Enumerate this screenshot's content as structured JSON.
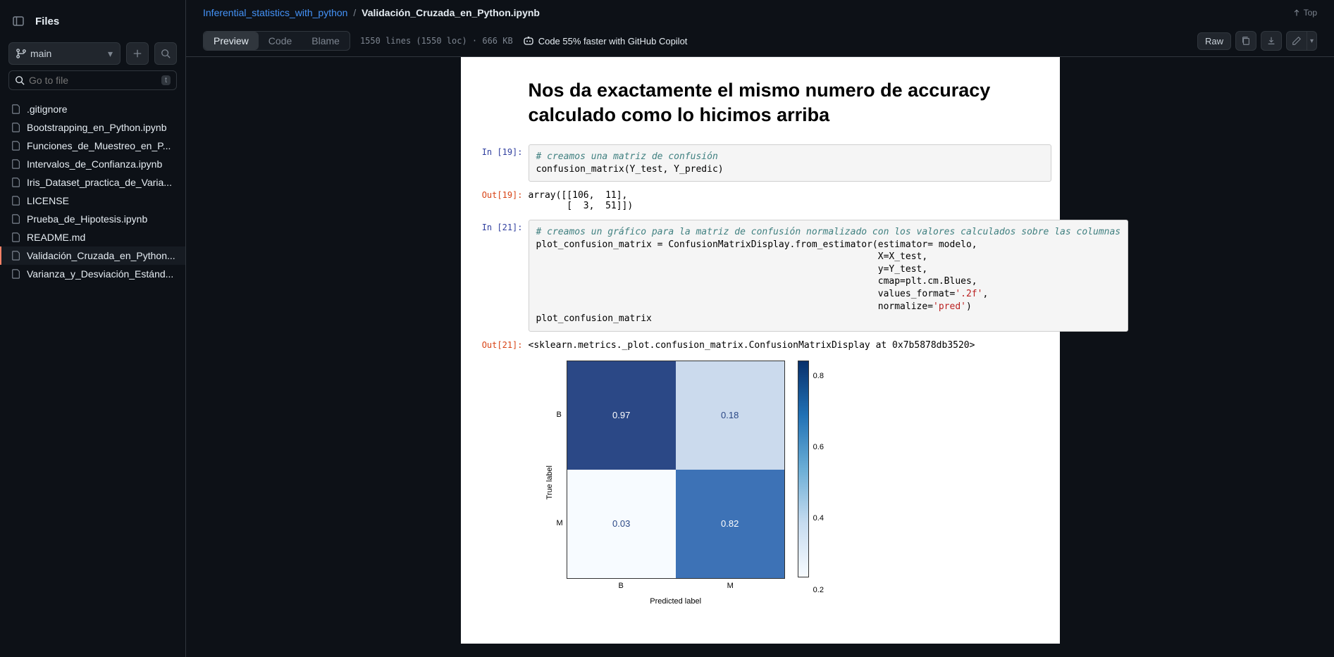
{
  "sidebar": {
    "title": "Files",
    "branch": "main",
    "searchPlaceholder": "Go to file",
    "searchKey": "t",
    "files": [
      ".gitignore",
      "Bootstrapping_en_Python.ipynb",
      "Funciones_de_Muestreo_en_P...",
      "Intervalos_de_Confianza.ipynb",
      "Iris_Dataset_practica_de_Varia...",
      "LICENSE",
      "Prueba_de_Hipotesis.ipynb",
      "README.md",
      "Validación_Cruzada_en_Python...",
      "Varianza_y_Desviación_Estánd..."
    ],
    "activeIndex": 8
  },
  "breadcrumb": {
    "repo": "Inferential_statistics_with_python",
    "file": "Validación_Cruzada_en_Python.ipynb",
    "topLabel": "Top"
  },
  "toolbar": {
    "tabs": [
      "Preview",
      "Code",
      "Blame"
    ],
    "activeTab": 0,
    "meta": "1550 lines (1550 loc) · 666 KB",
    "copilot": "Code 55% faster with GitHub Copilot",
    "raw": "Raw"
  },
  "notebook": {
    "heading": "Nos da exactamente el mismo numero de accuracy calculado como lo hicimos arriba",
    "prompts": {
      "in19": "In [19]:",
      "out19": "Out[19]:",
      "in21": "In [21]:",
      "out21": "Out[21]:"
    },
    "code19_comment": "# creamos una matriz de confusión",
    "code19_line": "confusion_matrix(Y_test, Y_predic)",
    "out19_text": "array([[106,  11],\n       [  3,  51]])",
    "code21_comment": "# creamos un gráfico para la matriz de confusión normalizado con los valores calculados sobre las columnas",
    "code21_body": "plot_confusion_matrix = ConfusionMatrixDisplay.from_estimator(estimator= modelo,\n                                                              X=X_test,\n                                                              y=Y_test,\n                                                              cmap=plt.cm.Blues,\n                                                              values_format=",
    "code21_str1": "'.2f'",
    "code21_body2": ",\n                                                              normalize=",
    "code21_str2": "'pred'",
    "code21_body3": ")\nplot_confusion_matrix",
    "out21_text": "<sklearn.metrics._plot.confusion_matrix.ConfusionMatrixDisplay at 0x7b5878db3520>"
  },
  "chart_data": {
    "type": "heatmap",
    "title": "",
    "xlabel": "Predicted label",
    "ylabel": "True label",
    "x_categories": [
      "B",
      "M"
    ],
    "y_categories": [
      "B",
      "M"
    ],
    "cells": [
      [
        0.97,
        0.18
      ],
      [
        0.03,
        0.82
      ]
    ],
    "colorbar_ticks": [
      "0.8",
      "0.6",
      "0.4",
      "0.2"
    ],
    "cell_colors": [
      [
        "#2b4886",
        "#cbdaed"
      ],
      [
        "#f7fbff",
        "#3d72b6"
      ]
    ],
    "cell_text_colors": [
      [
        "#fff",
        "#2b4886"
      ],
      [
        "#2b4886",
        "#fff"
      ]
    ]
  }
}
